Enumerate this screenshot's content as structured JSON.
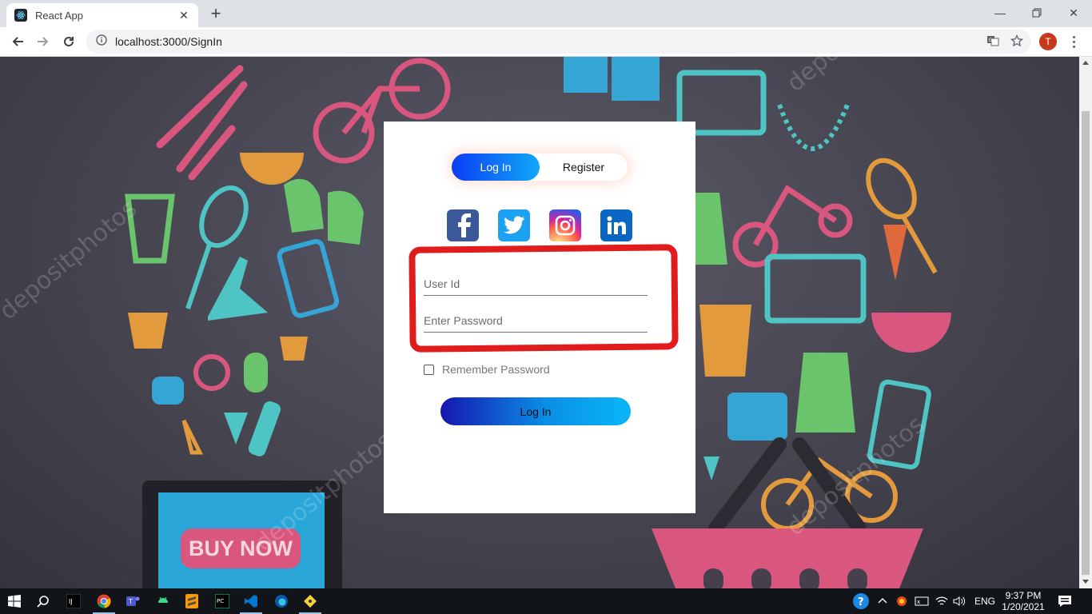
{
  "browser": {
    "tab_title": "React App",
    "url": "localhost:3000/SignIn",
    "profile_initial": "T"
  },
  "auth": {
    "toggle_login": "Log In",
    "toggle_register": "Register",
    "social": [
      "facebook-icon",
      "twitter-icon",
      "instagram-icon",
      "linkedin-icon"
    ],
    "userid_placeholder": "User Id",
    "password_placeholder": "Enter Password",
    "remember_label": "Remember Password",
    "submit_label": "Log In"
  },
  "background": {
    "banner_text": "BUY NOW"
  },
  "taskbar": {
    "language": "ENG",
    "time": "9:37 PM",
    "date": "1/20/2021"
  },
  "colors": {
    "accent_blue": "#0b3df5",
    "highlight_red": "#e01c1c"
  }
}
